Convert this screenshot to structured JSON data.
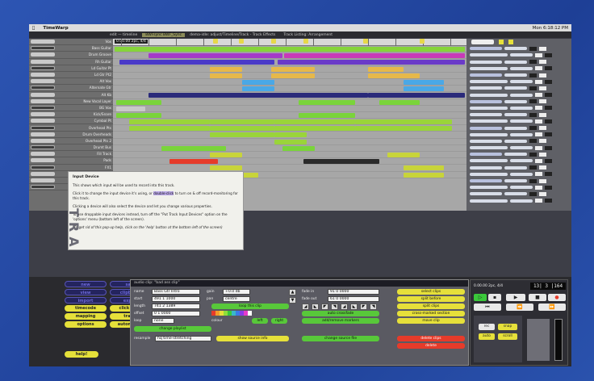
{
  "app": {
    "name": "TimeWarp",
    "clock": "Mon 6:18:12 PM"
  },
  "tabs": [
    {
      "label": "edit — timeline",
      "active": false
    },
    {
      "label": "BWFsync BWF_Sync",
      "active": true
    },
    {
      "label": "dema-idle: adjust/Timeline/Track - Track Effects",
      "active": false
    },
    {
      "label": "Track Listing: Arrangement",
      "active": false
    }
  ],
  "ruler": {
    "position": "0.00.00 2pc, 4/4"
  },
  "tracks": [
    "Vox",
    "Bass Guitar",
    "Drum Groove",
    "Rh Guitar",
    "Ld Guitar Pt",
    "Ld Gtr Pt2",
    "Alt Vox",
    "Alternate Gtr",
    "Alt Kb",
    "New Vocal Layer",
    "BG Vox",
    "Kick/Snare",
    "Cymbal Pt",
    "Overhead Pts",
    "Drum Overheads",
    "Overhead Pts 2",
    "Drumt Bus",
    "Fill Track",
    "Pads",
    "FX1",
    "FX2",
    "FX3",
    "Aux"
  ],
  "help": {
    "title": "Input Device",
    "p1": "This shows which input will be used to record into this track.",
    "p2a": "Click it to change the input device it's using, or ",
    "p2b": "double-click",
    "p2c": " to turn on & off record-monitoring for this track.",
    "p3": "Clicking a device will also select the device and let you change various properties.",
    "p4": "To use droppable input devices instead, turn off the \"Put Track Input Devices\" option on the 'options' menu (bottom left of the screen).",
    "p5": "(To get rid of this pop-up help, click on the 'help' button at the bottom left of the screen)"
  },
  "watermark": "TRA",
  "left_panel": {
    "col1": [
      "new",
      "view",
      "import",
      "timecode",
      "mapping",
      "options",
      "help!"
    ],
    "col2": [
      "save",
      "clipboard",
      "export",
      "click track",
      "tracks",
      "automation"
    ]
  },
  "editor": {
    "header": "audio clip: \"bad ass clip\"",
    "name_label": "name",
    "name_value": "Bass Gtr Intro",
    "start_label": "start",
    "start_value": "491 1 1000",
    "length_label": "length",
    "length_value": "741 2 1389",
    "offset_label": "offset",
    "offset_value": "0 1 0000",
    "loop_label": "loop",
    "loop_value": "none",
    "gain_label": "gain",
    "gain_value": "+0.0 db",
    "pan_label": "pan",
    "pan_value": "centre",
    "fade_in_label": "fade in",
    "fade_in_value": "91 0 0000",
    "fade_out_label": "fade out",
    "fade_out_value": "61 0 0000",
    "loop_clip": "loop this clip",
    "change_playlist": "change playlist",
    "show_source": "show source info",
    "change_source": "change source file",
    "auto_crossfade": "auto crossfade",
    "add_remove_markers": "add/remove markers",
    "left": "left",
    "right": "right",
    "colour_label": "colour",
    "resample_label": "resample",
    "resample_value": "hq time-stretching",
    "colours": [
      "#e63b2a",
      "#f29c2a",
      "#e6e03a",
      "#8fe03a",
      "#3ac83a",
      "#3ab8c8",
      "#3a7ae6",
      "#8a3ae6",
      "#e63ac8",
      "#ffffff"
    ],
    "right_buttons": [
      "select clips",
      "split before",
      "split clips",
      "cross-marked section",
      "move clip"
    ],
    "red_buttons": [
      "delete clips",
      "delete"
    ]
  },
  "transport": {
    "position": "0.00.00 2pc, 4/4",
    "clock": "13| 3 |164",
    "labels": [
      "play",
      "rewind",
      "record",
      "loop",
      "punch",
      "click",
      "snap"
    ],
    "small": [
      "rec",
      "snap",
      "auto",
      "scroll"
    ]
  }
}
